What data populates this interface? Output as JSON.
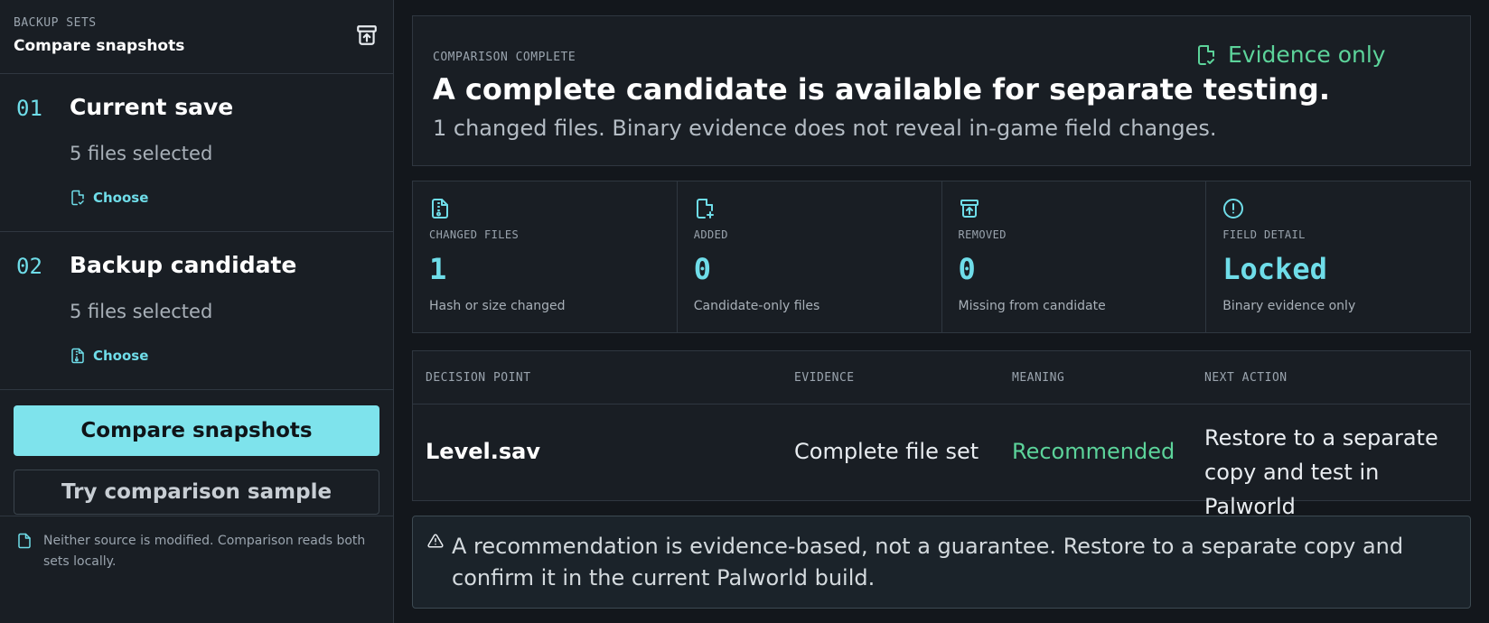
{
  "sidebar": {
    "eyebrow": "BACKUP SETS",
    "title": "Compare snapshots",
    "header_icon": "archive-upload-icon",
    "steps": [
      {
        "number": "01",
        "title": "Current save",
        "count": "5 files selected",
        "choose_label": "Choose",
        "choose_icon": "file-check-icon"
      },
      {
        "number": "02",
        "title": "Backup candidate",
        "count": "5 files selected",
        "choose_label": "Choose",
        "choose_icon": "file-archive-icon"
      }
    ],
    "primary_button": "Compare snapshots",
    "secondary_button": "Try comparison sample",
    "note": "Neither source is modified. Comparison reads both sets locally.",
    "note_icon": "file-icon"
  },
  "summary": {
    "eyebrow": "COMPARISON COMPLETE",
    "heading": "A complete candidate is available for separate testing.",
    "subtext": "1 changed files. Binary evidence does not reveal in-game field changes.",
    "badge": "Evidence only",
    "badge_icon": "file-check-icon"
  },
  "stats": [
    {
      "icon": "file-archive-icon",
      "label": "CHANGED FILES",
      "value": "1",
      "desc": "Hash or size changed"
    },
    {
      "icon": "file-plus-icon",
      "label": "ADDED",
      "value": "0",
      "desc": "Candidate-only files"
    },
    {
      "icon": "archive-upload-icon",
      "label": "REMOVED",
      "value": "0",
      "desc": "Missing from candidate"
    },
    {
      "icon": "alert-circle-icon",
      "label": "FIELD DETAIL",
      "value": "Locked",
      "desc": "Binary evidence only"
    }
  ],
  "table": {
    "headers": [
      "DECISION POINT",
      "EVIDENCE",
      "MEANING",
      "NEXT ACTION"
    ],
    "rows": [
      {
        "file": "Level.sav",
        "evidence": "Complete file set",
        "meaning": "Recommended",
        "action": "Restore to a separate copy and test in Palworld"
      }
    ]
  },
  "notice": {
    "icon": "warning-triangle-icon",
    "text": "A recommendation is evidence-based, not a guarantee. Restore to a separate copy and confirm it in the current Palworld build."
  },
  "colors": {
    "accent": "#6fdde9",
    "button": "#7ee3ec",
    "success": "#5cd39a",
    "background": "#13171c",
    "panel": "#191e24"
  }
}
